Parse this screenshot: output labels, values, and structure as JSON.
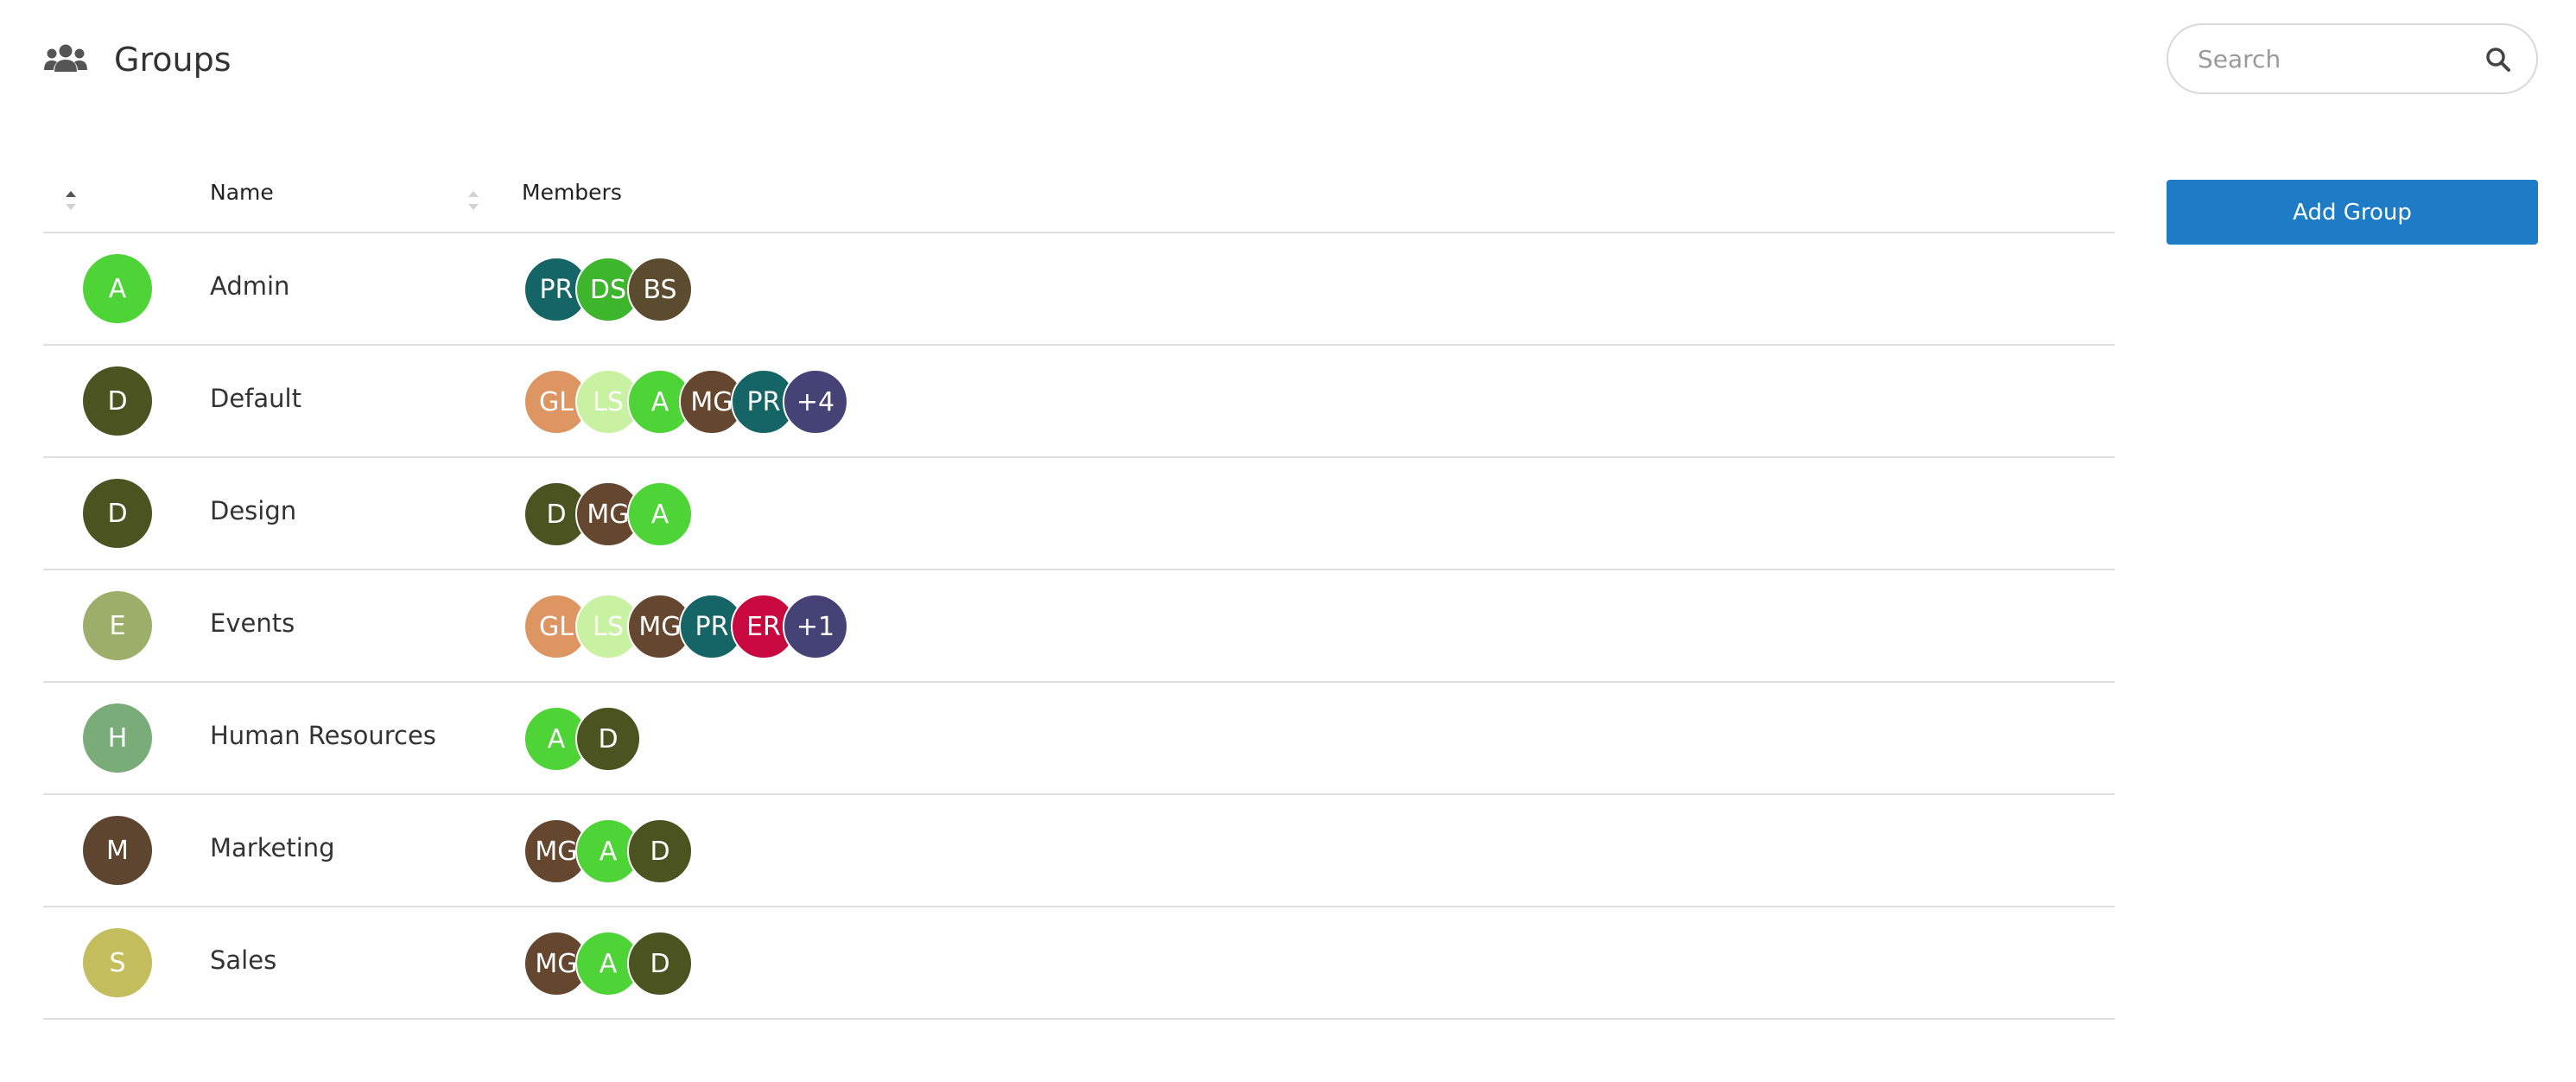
{
  "header": {
    "title": "Groups",
    "icon": "users-icon"
  },
  "search": {
    "placeholder": "Search",
    "value": "",
    "icon": "search-icon"
  },
  "actions": {
    "add_group_label": "Add Group",
    "accent": "#1e7bc6"
  },
  "table": {
    "columns": [
      "Name",
      "Members"
    ],
    "rows": [
      {
        "initial": "A",
        "name": "Admin",
        "color": "#4fd438",
        "members": [
          {
            "label": "PR",
            "color": "#166566"
          },
          {
            "label": "DS",
            "color": "#3db52d"
          },
          {
            "label": "BS",
            "color": "#5c4c2f"
          }
        ]
      },
      {
        "initial": "D",
        "name": "Default",
        "color": "#4b5320",
        "members": [
          {
            "label": "GL",
            "color": "#dd9561"
          },
          {
            "label": "LS",
            "color": "#c8f1a2"
          },
          {
            "label": "A",
            "color": "#4fd438"
          },
          {
            "label": "MG",
            "color": "#65462f"
          },
          {
            "label": "PR",
            "color": "#166566"
          },
          {
            "label": "+4",
            "color": "#454376"
          }
        ]
      },
      {
        "initial": "D",
        "name": "Design",
        "color": "#4b5320",
        "members": [
          {
            "label": "D",
            "color": "#4b5320"
          },
          {
            "label": "MG",
            "color": "#65462f"
          },
          {
            "label": "A",
            "color": "#4fd438"
          }
        ]
      },
      {
        "initial": "E",
        "name": "Events",
        "color": "#9dae6b",
        "members": [
          {
            "label": "GL",
            "color": "#dd9561"
          },
          {
            "label": "LS",
            "color": "#c8f1a2"
          },
          {
            "label": "MG",
            "color": "#65462f"
          },
          {
            "label": "PR",
            "color": "#166566"
          },
          {
            "label": "ER",
            "color": "#c8093f"
          },
          {
            "label": "+1",
            "color": "#454376"
          }
        ]
      },
      {
        "initial": "H",
        "name": "Human Resources",
        "color": "#7aac7a",
        "members": [
          {
            "label": "A",
            "color": "#4fd438"
          },
          {
            "label": "D",
            "color": "#4b5320"
          }
        ]
      },
      {
        "initial": "M",
        "name": "Marketing",
        "color": "#5e4530",
        "members": [
          {
            "label": "MG",
            "color": "#65462f"
          },
          {
            "label": "A",
            "color": "#4fd438"
          },
          {
            "label": "D",
            "color": "#4b5320"
          }
        ]
      },
      {
        "initial": "S",
        "name": "Sales",
        "color": "#c4bd5e",
        "members": [
          {
            "label": "MG",
            "color": "#65462f"
          },
          {
            "label": "A",
            "color": "#4fd438"
          },
          {
            "label": "D",
            "color": "#4b5320"
          }
        ]
      }
    ]
  }
}
